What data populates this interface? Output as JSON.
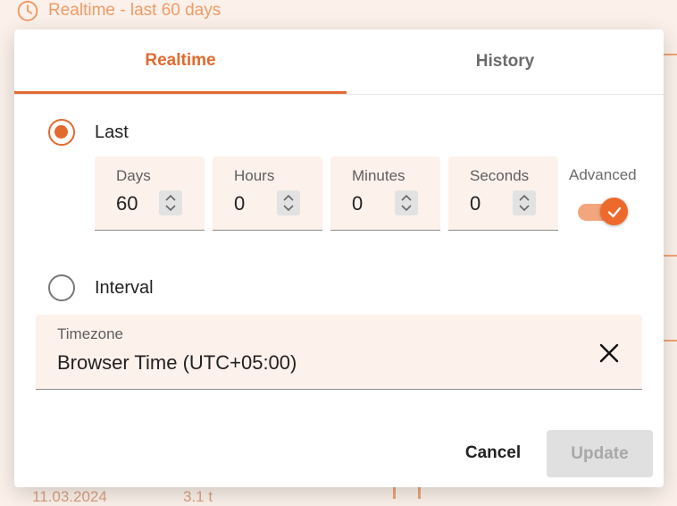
{
  "background": {
    "header_text": "Realtime - last 60 days",
    "row_date": "11.03.2024",
    "row_value": "3.1 t"
  },
  "dialog": {
    "tabs": [
      {
        "label": "Realtime",
        "active": true
      },
      {
        "label": "History",
        "active": false
      }
    ],
    "last_option": {
      "label": "Last",
      "checked": true
    },
    "fields": [
      {
        "label": "Days",
        "value": "60"
      },
      {
        "label": "Hours",
        "value": "0"
      },
      {
        "label": "Minutes",
        "value": "0"
      },
      {
        "label": "Seconds",
        "value": "0"
      }
    ],
    "advanced": {
      "label": "Advanced",
      "enabled": true
    },
    "interval_option": {
      "label": "Interval",
      "checked": false
    },
    "timezone": {
      "label": "Timezone",
      "value": "Browser Time (UTC+05:00)"
    },
    "buttons": {
      "cancel": "Cancel",
      "update": "Update"
    }
  },
  "colors": {
    "accent": "#e36a2f",
    "accent_light": "#f3a57b",
    "field_bg": "#fdf1ec",
    "disabled_bg": "#e0e0e0"
  },
  "icons": {
    "header": "clock-icon",
    "stepper": "chevron-up-down-icon",
    "clear": "close-icon",
    "toggle": "check-icon"
  }
}
